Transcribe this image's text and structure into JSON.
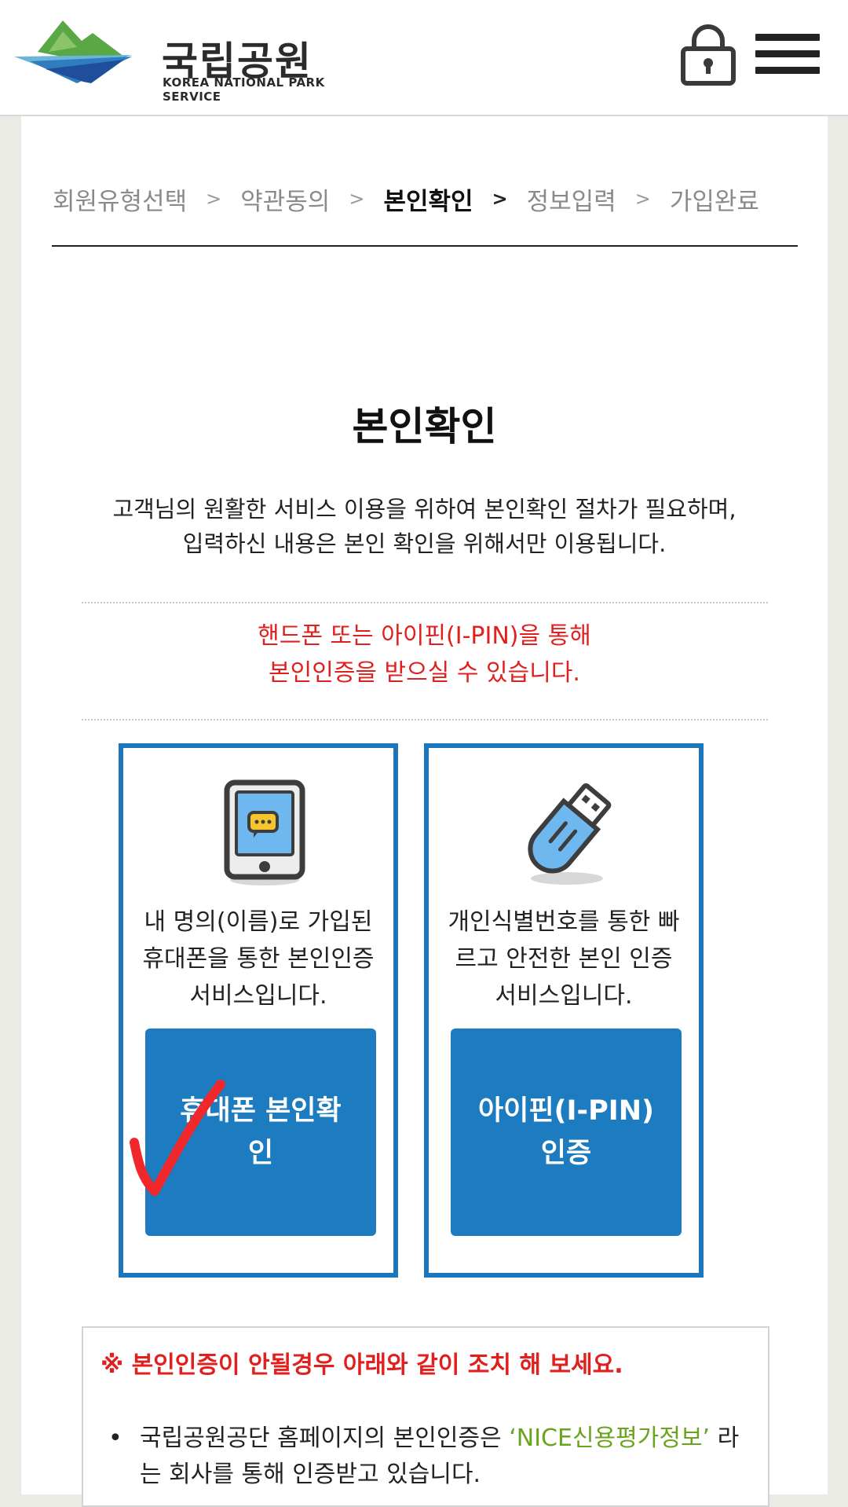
{
  "header": {
    "logo_ko": "국립공원",
    "logo_en": "KOREA NATIONAL PARK SERVICE",
    "icons": [
      "lock-icon",
      "hamburger-menu-icon"
    ]
  },
  "steps": [
    {
      "label": "회원유형선택",
      "active": false
    },
    {
      "label": "약관동의",
      "active": false
    },
    {
      "label": "본인확인",
      "active": true
    },
    {
      "label": "정보입력",
      "active": false
    },
    {
      "label": "가입완료",
      "active": false
    }
  ],
  "main": {
    "title": "본인확인",
    "desc_line1": "고객님의 원활한 서비스 이용을 위하여 본인확인 절차가 필요하며,",
    "desc_line2": "입력하신 내용은 본인 확인을 위해서만 이용됩니다.",
    "notice_line1": "핸드폰 또는 아이핀(I-PIN)을 통해",
    "notice_line2": "본인인증을 받으실 수 있습니다."
  },
  "cards": [
    {
      "icon": "mobile-phone-icon",
      "text": "내 명의(이름)로 가입된 휴대폰을 통한 본인인증 서비스입니다.",
      "button": "휴대폰 본인확인"
    },
    {
      "icon": "usb-key-icon",
      "text": "개인식별번호를 통한 빠르고 안전한 본인 인증 서비스입니다.",
      "button": "아이핀(I-PIN) 인증"
    }
  ],
  "trouble": {
    "heading": "※ 본인인증이 안될경우 아래와 같이 조치 해 보세요.",
    "item_before": "국립공원공단 홈페이지의 본인인증은 ",
    "item_highlight": "‘NICE신용평가정보’",
    "item_after": " 라는 회사를 통해 인증받고 있습니다."
  },
  "colors": {
    "accent_blue": "#1b76bc",
    "notice_red": "#e0201f",
    "highlight_green": "#6aa41e"
  }
}
